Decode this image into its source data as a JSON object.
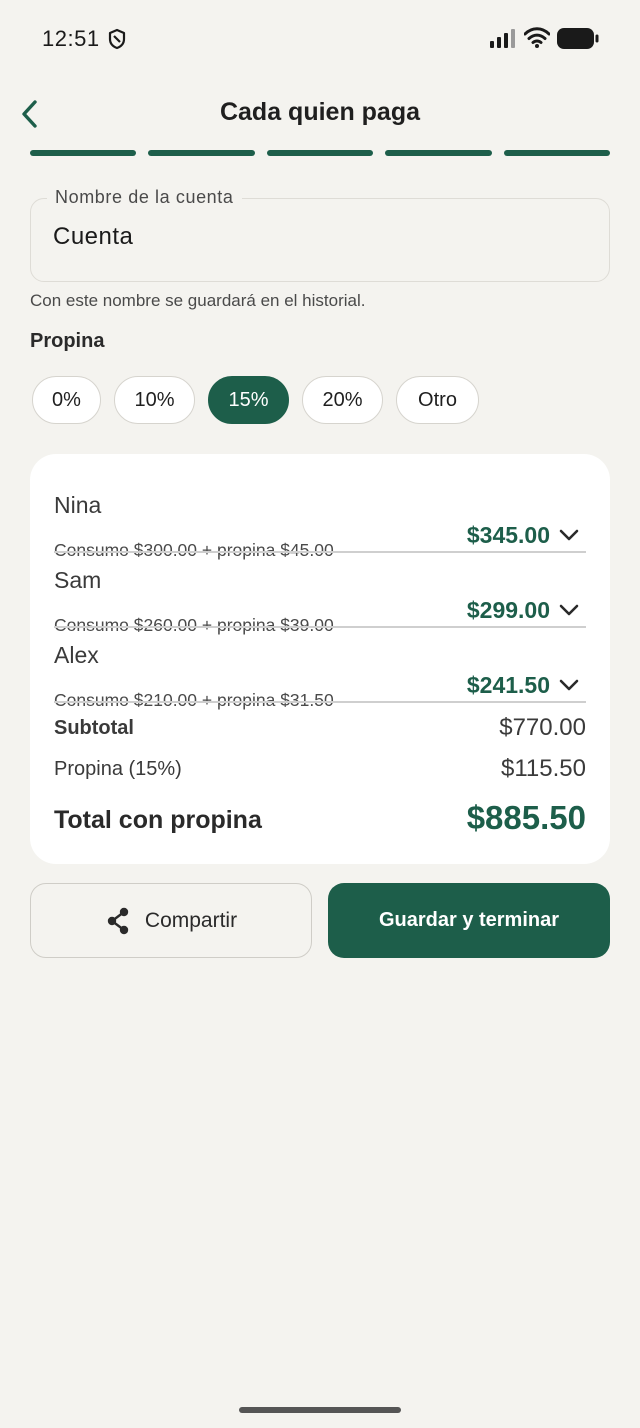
{
  "status_bar": {
    "time": "12:51"
  },
  "header": {
    "title": "Cada quien paga"
  },
  "progress": {
    "total_steps": 5,
    "completed_steps": 5
  },
  "account": {
    "label": "Nombre de la cuenta",
    "value": "Cuenta",
    "helper": "Con este nombre se guardará en el historial."
  },
  "tip": {
    "title": "Propina",
    "options": [
      "0%",
      "10%",
      "15%",
      "20%",
      "Otro"
    ],
    "selected": "15%"
  },
  "people": [
    {
      "name": "Nina",
      "detail": "Consumo $300.00 + propina $45.00",
      "amount": "$345.00"
    },
    {
      "name": "Sam",
      "detail": "Consumo $260.00 + propina $39.00",
      "amount": "$299.00"
    },
    {
      "name": "Alex",
      "detail": "Consumo $210.00 + propina $31.50",
      "amount": "$241.50"
    }
  ],
  "summary": {
    "subtotal_label": "Subtotal",
    "subtotal_value": "$770.00",
    "tip_label": "Propina (15%)",
    "tip_value": "$115.50",
    "total_label": "Total con propina",
    "total_value": "$885.50"
  },
  "actions": {
    "share_label": "Compartir",
    "save_label": "Guardar y terminar"
  },
  "colors": {
    "accent": "#1d5e4a",
    "background": "#f4f3ef",
    "card": "#ffffff"
  }
}
